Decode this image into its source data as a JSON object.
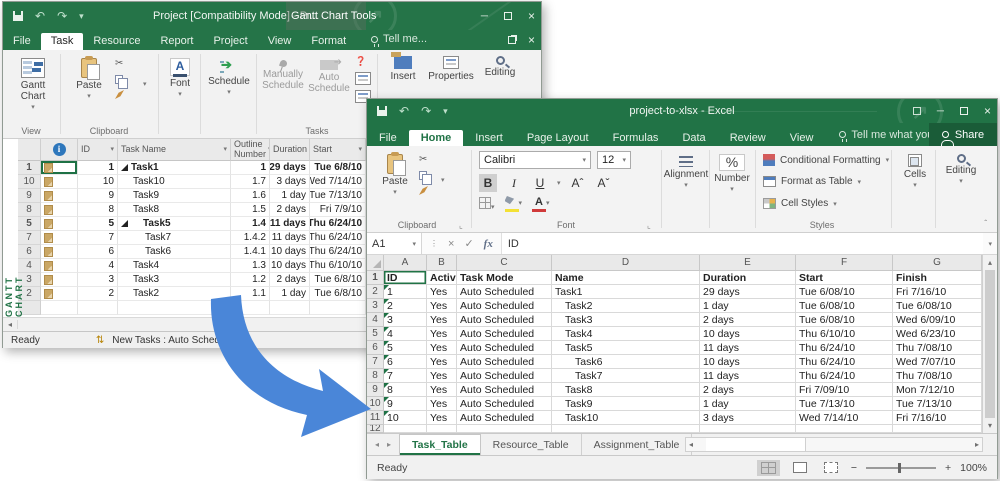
{
  "colors": {
    "excel_green": "#217346",
    "project_green": "#257448",
    "arrow_blue": "#4a86d8",
    "note_tan": "#caa765",
    "selection_green": "#1e7145"
  },
  "project": {
    "title": "Project [Compatibility Mode] - Pr...",
    "contextual_title": "Gantt Chart Tools",
    "tabs": [
      {
        "label": "File"
      },
      {
        "label": "Task",
        "active": true
      },
      {
        "label": "Resource"
      },
      {
        "label": "Report"
      },
      {
        "label": "Project"
      },
      {
        "label": "View"
      },
      {
        "label": "Format"
      }
    ],
    "tell_me": "Tell me...",
    "ribbon": {
      "gantt_chart": "Gantt Chart",
      "paste": "Paste",
      "font": "Font",
      "schedule": "Schedule",
      "manually_schedule": "Manually Schedule",
      "auto_schedule": "Auto Schedule",
      "insert": "Insert",
      "properties": "Properties",
      "editing": "Editing",
      "groups": {
        "view": "View",
        "clipboard": "Clipboard",
        "tasks": "Tasks"
      }
    },
    "view_label": "GANTT CHART",
    "table": {
      "columns": {
        "id": "ID",
        "task_name": "Task Name",
        "outline_number": "Outline Number",
        "duration": "Duration",
        "start": "Start"
      },
      "rows": [
        {
          "row": "1",
          "id": "1",
          "name": "Task1",
          "indent": 0,
          "summary": true,
          "selected": true,
          "outline": "1",
          "duration": "29 days",
          "start": "Tue 6/8/10"
        },
        {
          "row": "10",
          "id": "10",
          "name": "Task10",
          "indent": 1,
          "outline": "1.7",
          "duration": "3 days",
          "start": "Wed 7/14/10"
        },
        {
          "row": "9",
          "id": "9",
          "name": "Task9",
          "indent": 1,
          "outline": "1.6",
          "duration": "1 day",
          "start": "Tue 7/13/10"
        },
        {
          "row": "8",
          "id": "8",
          "name": "Task8",
          "indent": 1,
          "outline": "1.5",
          "duration": "2 days",
          "start": "Fri 7/9/10"
        },
        {
          "row": "5",
          "id": "5",
          "name": "Task5",
          "indent": 1,
          "summary": true,
          "outline": "1.4",
          "duration": "11 days",
          "start": "Thu 6/24/10"
        },
        {
          "row": "7",
          "id": "7",
          "name": "Task7",
          "indent": 2,
          "outline": "1.4.2",
          "duration": "11 days",
          "start": "Thu 6/24/10"
        },
        {
          "row": "6",
          "id": "6",
          "name": "Task6",
          "indent": 2,
          "outline": "1.4.1",
          "duration": "10 days",
          "start": "Thu 6/24/10"
        },
        {
          "row": "4",
          "id": "4",
          "name": "Task4",
          "indent": 1,
          "outline": "1.3",
          "duration": "10 days",
          "start": "Thu 6/10/10"
        },
        {
          "row": "3",
          "id": "3",
          "name": "Task3",
          "indent": 1,
          "outline": "1.2",
          "duration": "2 days",
          "start": "Tue 6/8/10"
        },
        {
          "row": "2",
          "id": "2",
          "name": "Task2",
          "indent": 1,
          "outline": "1.1",
          "duration": "1 day",
          "start": "Tue 6/8/10"
        }
      ]
    },
    "status": {
      "ready": "Ready",
      "new_tasks": "New Tasks : Auto Scheduled"
    }
  },
  "excel": {
    "title": "project-to-xlsx - Excel",
    "tabs": [
      {
        "label": "File"
      },
      {
        "label": "Home",
        "active": true
      },
      {
        "label": "Insert"
      },
      {
        "label": "Page Layout"
      },
      {
        "label": "Formulas"
      },
      {
        "label": "Data"
      },
      {
        "label": "Review"
      },
      {
        "label": "View"
      }
    ],
    "tell_me": "Tell me what you want to do...",
    "share": "Share",
    "ribbon": {
      "paste": "Paste",
      "clipboard_group": "Clipboard",
      "font_name": "Calibri",
      "font_size": "12",
      "bold": "B",
      "italic": "I",
      "underline": "U",
      "font_group": "Font",
      "alignment": "Alignment",
      "number_group": "Number",
      "percent": "%",
      "conditional_formatting": "Conditional Formatting",
      "format_as_table": "Format as Table",
      "cell_styles": "Cell Styles",
      "styles_group": "Styles",
      "cells": "Cells",
      "editing": "Editing"
    },
    "formula_bar": {
      "name_box": "A1",
      "fx": "fx",
      "value": "ID"
    },
    "sheet": {
      "col_headers": [
        "A",
        "B",
        "C",
        "D",
        "E",
        "F",
        "G"
      ],
      "header_row": {
        "row": "1",
        "cells": [
          "ID",
          "Active",
          "Task Mode",
          "Name",
          "Duration",
          "Start",
          "Finish"
        ]
      },
      "rows": [
        {
          "row": "2",
          "id": "1",
          "active": "Yes",
          "mode": "Auto Scheduled",
          "name": "Task1",
          "indent": 0,
          "selected": true,
          "duration": "29 days",
          "start": "Tue 6/08/10",
          "finish": "Fri 7/16/10"
        },
        {
          "row": "3",
          "id": "2",
          "active": "Yes",
          "mode": "Auto Scheduled",
          "name": "Task2",
          "indent": 1,
          "duration": "1 day",
          "start": "Tue 6/08/10",
          "finish": "Tue 6/08/10"
        },
        {
          "row": "4",
          "id": "3",
          "active": "Yes",
          "mode": "Auto Scheduled",
          "name": "Task3",
          "indent": 1,
          "duration": "2 days",
          "start": "Tue 6/08/10",
          "finish": "Wed 6/09/10"
        },
        {
          "row": "5",
          "id": "4",
          "active": "Yes",
          "mode": "Auto Scheduled",
          "name": "Task4",
          "indent": 1,
          "duration": "10 days",
          "start": "Thu 6/10/10",
          "finish": "Wed 6/23/10"
        },
        {
          "row": "6",
          "id": "5",
          "active": "Yes",
          "mode": "Auto Scheduled",
          "name": "Task5",
          "indent": 1,
          "duration": "11 days",
          "start": "Thu 6/24/10",
          "finish": "Thu 7/08/10"
        },
        {
          "row": "7",
          "id": "6",
          "active": "Yes",
          "mode": "Auto Scheduled",
          "name": "Task6",
          "indent": 2,
          "duration": "10 days",
          "start": "Thu 6/24/10",
          "finish": "Wed 7/07/10"
        },
        {
          "row": "8",
          "id": "7",
          "active": "Yes",
          "mode": "Auto Scheduled",
          "name": "Task7",
          "indent": 2,
          "duration": "11 days",
          "start": "Thu 6/24/10",
          "finish": "Thu 7/08/10"
        },
        {
          "row": "9",
          "id": "8",
          "active": "Yes",
          "mode": "Auto Scheduled",
          "name": "Task8",
          "indent": 1,
          "duration": "2 days",
          "start": "Fri 7/09/10",
          "finish": "Mon 7/12/10"
        },
        {
          "row": "10",
          "id": "9",
          "active": "Yes",
          "mode": "Auto Scheduled",
          "name": "Task9",
          "indent": 1,
          "duration": "1 day",
          "start": "Tue 7/13/10",
          "finish": "Tue 7/13/10"
        },
        {
          "row": "11",
          "id": "10",
          "active": "Yes",
          "mode": "Auto Scheduled",
          "name": "Task10",
          "indent": 1,
          "duration": "3 days",
          "start": "Wed 7/14/10",
          "finish": "Fri 7/16/10"
        }
      ],
      "partial_row": "12"
    },
    "sheet_tabs": [
      {
        "label": "Task_Table",
        "active": true
      },
      {
        "label": "Resource_Table"
      },
      {
        "label": "Assignment_Table"
      }
    ],
    "status": {
      "ready": "Ready",
      "zoom": "100%"
    }
  }
}
